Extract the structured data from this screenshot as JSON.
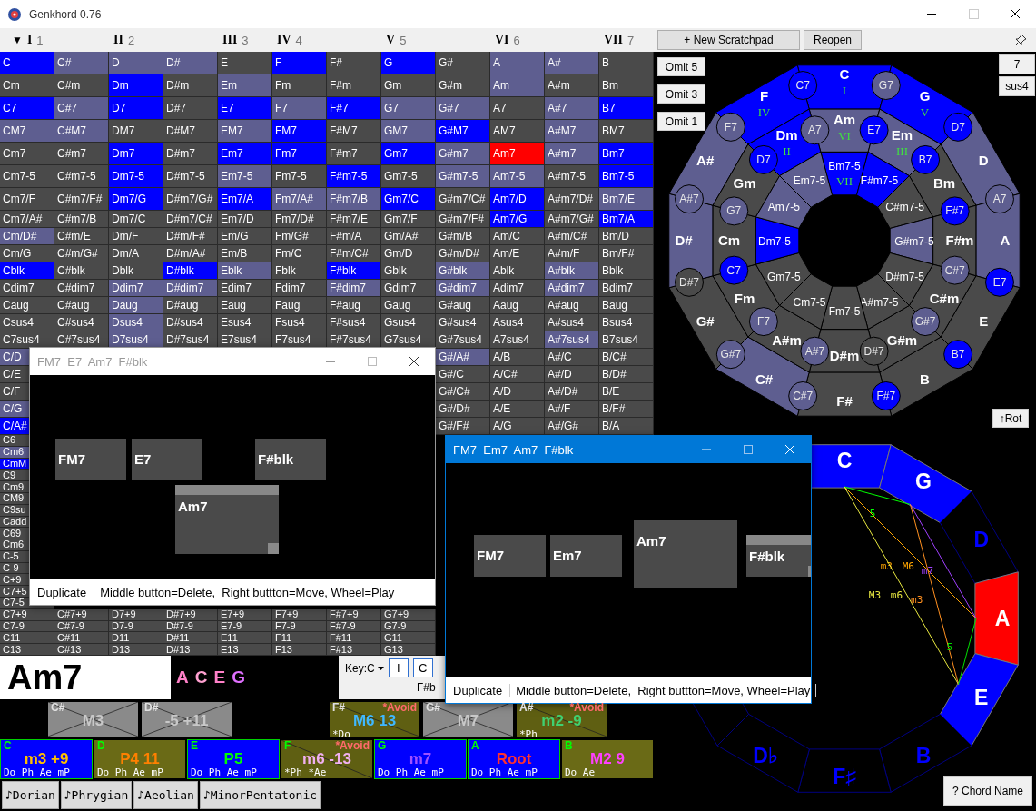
{
  "window": {
    "title": "Genkhord 0.76"
  },
  "toolbar": {
    "columns": [
      {
        "caret": "▼",
        "degree": "I",
        "number": "1"
      },
      {},
      {
        "degree": "II",
        "number": "2"
      },
      {},
      {
        "degree": "III",
        "number": "3"
      },
      {
        "degree": "IV",
        "number": "4"
      },
      {},
      {
        "degree": "V",
        "number": "5"
      },
      {},
      {
        "degree": "VI",
        "number": "6"
      },
      {},
      {
        "degree": "VII",
        "number": "7"
      }
    ],
    "buttons": [
      "+ New Scratchpad",
      "Reopen"
    ]
  },
  "grid": {
    "rows": [
      {
        "cells": [
          {
            "label": "C",
            "color": "#0000ff"
          },
          {
            "label": "C#",
            "color": "#5e5e90"
          },
          {
            "label": "D",
            "color": "#5e5e90"
          },
          {
            "label": "D#",
            "color": "#5e5e90"
          },
          {
            "label": "E",
            "color": "#4a4a4a"
          },
          {
            "label": "F",
            "color": "#0000ff"
          },
          {
            "label": "F#",
            "color": "#4a4a4a"
          },
          {
            "label": "G",
            "color": "#0000ff"
          },
          {
            "label": "G#",
            "color": "#4a4a4a"
          },
          {
            "label": "A",
            "color": "#5e5e90"
          },
          {
            "label": "A#",
            "color": "#5e5e90"
          },
          {
            "label": "B",
            "color": "#4a4a4a"
          }
        ]
      },
      {
        "cells": [
          {
            "label": "Cm",
            "color": "#4a4a4a"
          },
          {
            "label": "C#m",
            "color": "#4a4a4a"
          },
          {
            "label": "Dm",
            "color": "#0000ff"
          },
          {
            "label": "D#m",
            "color": "#4a4a4a"
          },
          {
            "label": "Em",
            "color": "#5e5e90"
          },
          {
            "label": "Fm",
            "color": "#4a4a4a"
          },
          {
            "label": "F#m",
            "color": "#4a4a4a"
          },
          {
            "label": "Gm",
            "color": "#4a4a4a"
          },
          {
            "label": "G#m",
            "color": "#4a4a4a"
          },
          {
            "label": "Am",
            "color": "#5e5e90"
          },
          {
            "label": "A#m",
            "color": "#4a4a4a"
          },
          {
            "label": "Bm",
            "color": "#4a4a4a"
          }
        ]
      },
      {
        "cells": [
          {
            "label": "C7",
            "color": "#0000ff"
          },
          {
            "label": "C#7",
            "color": "#5e5e90"
          },
          {
            "label": "D7",
            "color": "#0000ff"
          },
          {
            "label": "D#7",
            "color": "#4a4a4a"
          },
          {
            "label": "E7",
            "color": "#0000ff"
          },
          {
            "label": "F7",
            "color": "#5e5e90"
          },
          {
            "label": "F#7",
            "color": "#0000ff"
          },
          {
            "label": "G7",
            "color": "#5e5e90"
          },
          {
            "label": "G#7",
            "color": "#5e5e90"
          },
          {
            "label": "A7",
            "color": "#4a4a4a"
          },
          {
            "label": "A#7",
            "color": "#5e5e90"
          },
          {
            "label": "B7",
            "color": "#0000ff"
          }
        ]
      },
      {
        "cells": [
          {
            "label": "CM7",
            "color": "#5e5e90"
          },
          {
            "label": "C#M7",
            "color": "#5e5e90"
          },
          {
            "label": "DM7",
            "color": "#4a4a4a"
          },
          {
            "label": "D#M7",
            "color": "#4a4a4a"
          },
          {
            "label": "EM7",
            "color": "#5e5e90"
          },
          {
            "label": "FM7",
            "color": "#0000ff"
          },
          {
            "label": "F#M7",
            "color": "#4a4a4a"
          },
          {
            "label": "GM7",
            "color": "#5e5e90"
          },
          {
            "label": "G#M7",
            "color": "#0000ff"
          },
          {
            "label": "AM7",
            "color": "#4a4a4a"
          },
          {
            "label": "A#M7",
            "color": "#5e5e90"
          },
          {
            "label": "BM7",
            "color": "#4a4a4a"
          }
        ]
      },
      {
        "cells": [
          {
            "label": "Cm7",
            "color": "#4a4a4a"
          },
          {
            "label": "C#m7",
            "color": "#4a4a4a"
          },
          {
            "label": "Dm7",
            "color": "#0000ff"
          },
          {
            "label": "D#m7",
            "color": "#4a4a4a"
          },
          {
            "label": "Em7",
            "color": "#0000ff"
          },
          {
            "label": "Fm7",
            "color": "#0000ff"
          },
          {
            "label": "F#m7",
            "color": "#4a4a4a"
          },
          {
            "label": "Gm7",
            "color": "#0000ff"
          },
          {
            "label": "G#m7",
            "color": "#5e5e90"
          },
          {
            "label": "Am7",
            "color": "#ff0000"
          },
          {
            "label": "A#m7",
            "color": "#5e5e90"
          },
          {
            "label": "Bm7",
            "color": "#0000ff"
          }
        ]
      },
      {
        "cells": [
          {
            "label": "Cm7-5",
            "color": "#4a4a4a"
          },
          {
            "label": "C#m7-5",
            "color": "#4a4a4a"
          },
          {
            "label": "Dm7-5",
            "color": "#0000ff"
          },
          {
            "label": "D#m7-5",
            "color": "#4a4a4a"
          },
          {
            "label": "Em7-5",
            "color": "#5e5e90"
          },
          {
            "label": "Fm7-5",
            "color": "#4a4a4a"
          },
          {
            "label": "F#m7-5",
            "color": "#0000ff"
          },
          {
            "label": "Gm7-5",
            "color": "#4a4a4a"
          },
          {
            "label": "G#m7-5",
            "color": "#5e5e90"
          },
          {
            "label": "Am7-5",
            "color": "#5e5e90"
          },
          {
            "label": "A#m7-5",
            "color": "#4a4a4a"
          },
          {
            "label": "Bm7-5",
            "color": "#0000ff"
          }
        ]
      },
      {
        "cells": [
          {
            "label": "Cm7/F",
            "color": "#4a4a4a"
          },
          {
            "label": "C#m7/F#",
            "color": "#4a4a4a"
          },
          {
            "label": "Dm7/G",
            "color": "#0000ff"
          },
          {
            "label": "D#m7/G#",
            "color": "#4a4a4a"
          },
          {
            "label": "Em7/A",
            "color": "#0000ff"
          },
          {
            "label": "Fm7/A#",
            "color": "#5e5e90"
          },
          {
            "label": "F#m7/B",
            "color": "#5e5e90"
          },
          {
            "label": "Gm7/C",
            "color": "#0000ff"
          },
          {
            "label": "G#m7/C#",
            "color": "#4a4a4a"
          },
          {
            "label": "Am7/D",
            "color": "#0000ff"
          },
          {
            "label": "A#m7/D#",
            "color": "#4a4a4a"
          },
          {
            "label": "Bm7/E",
            "color": "#5e5e90"
          }
        ]
      },
      {
        "cells": [
          {
            "label": "Cm7/A#",
            "color": "#4a4a4a"
          },
          {
            "label": "C#m7/B",
            "color": "#4a4a4a"
          },
          {
            "label": "Dm7/C",
            "color": "#4a4a4a"
          },
          {
            "label": "D#m7/C#",
            "color": "#4a4a4a"
          },
          {
            "label": "Em7/D",
            "color": "#4a4a4a"
          },
          {
            "label": "Fm7/D#",
            "color": "#4a4a4a"
          },
          {
            "label": "F#m7/E",
            "color": "#4a4a4a"
          },
          {
            "label": "Gm7/F",
            "color": "#4a4a4a"
          },
          {
            "label": "G#m7/F#",
            "color": "#4a4a4a"
          },
          {
            "label": "Am7/G",
            "color": "#0000ff"
          },
          {
            "label": "A#m7/G#",
            "color": "#4a4a4a"
          },
          {
            "label": "Bm7/A",
            "color": "#0000ff"
          }
        ]
      },
      {
        "cells": [
          {
            "label": "Cm/D#",
            "color": "#5e5e90"
          },
          {
            "label": "C#m/E",
            "color": "#4a4a4a"
          },
          {
            "label": "Dm/F",
            "color": "#4a4a4a"
          },
          {
            "label": "D#m/F#",
            "color": "#4a4a4a"
          },
          {
            "label": "Em/G",
            "color": "#4a4a4a"
          },
          {
            "label": "Fm/G#",
            "color": "#4a4a4a"
          },
          {
            "label": "F#m/A",
            "color": "#4a4a4a"
          },
          {
            "label": "Gm/A#",
            "color": "#4a4a4a"
          },
          {
            "label": "G#m/B",
            "color": "#4a4a4a"
          },
          {
            "label": "Am/C",
            "color": "#4a4a4a"
          },
          {
            "label": "A#m/C#",
            "color": "#4a4a4a"
          },
          {
            "label": "Bm/D",
            "color": "#4a4a4a"
          }
        ]
      },
      {
        "cells": [
          {
            "label": "Cm/G",
            "color": "#4a4a4a"
          },
          {
            "label": "C#m/G#",
            "color": "#4a4a4a"
          },
          {
            "label": "Dm/A",
            "color": "#4a4a4a"
          },
          {
            "label": "D#m/A#",
            "color": "#4a4a4a"
          },
          {
            "label": "Em/B",
            "color": "#4a4a4a"
          },
          {
            "label": "Fm/C",
            "color": "#4a4a4a"
          },
          {
            "label": "F#m/C#",
            "color": "#4a4a4a"
          },
          {
            "label": "Gm/D",
            "color": "#4a4a4a"
          },
          {
            "label": "G#m/D#",
            "color": "#4a4a4a"
          },
          {
            "label": "Am/E",
            "color": "#4a4a4a"
          },
          {
            "label": "A#m/F",
            "color": "#4a4a4a"
          },
          {
            "label": "Bm/F#",
            "color": "#4a4a4a"
          }
        ]
      },
      {
        "cells": [
          {
            "label": "Cblk",
            "color": "#0000ff"
          },
          {
            "label": "C#blk",
            "color": "#4a4a4a"
          },
          {
            "label": "Dblk",
            "color": "#4a4a4a"
          },
          {
            "label": "D#blk",
            "color": "#0000ff"
          },
          {
            "label": "Eblk",
            "color": "#5e5e90"
          },
          {
            "label": "Fblk",
            "color": "#4a4a4a"
          },
          {
            "label": "F#blk",
            "color": "#0000ff"
          },
          {
            "label": "Gblk",
            "color": "#4a4a4a"
          },
          {
            "label": "G#blk",
            "color": "#5e5e90"
          },
          {
            "label": "Ablk",
            "color": "#4a4a4a"
          },
          {
            "label": "A#blk",
            "color": "#5e5e90"
          },
          {
            "label": "Bblk",
            "color": "#4a4a4a"
          }
        ]
      },
      {
        "cells": [
          {
            "label": "Cdim7",
            "color": "#4a4a4a"
          },
          {
            "label": "C#dim7",
            "color": "#4a4a4a"
          },
          {
            "label": "Ddim7",
            "color": "#5e5e90"
          },
          {
            "label": "D#dim7",
            "color": "#5e5e90"
          },
          {
            "label": "Edim7",
            "color": "#4a4a4a"
          },
          {
            "label": "Fdim7",
            "color": "#4a4a4a"
          },
          {
            "label": "F#dim7",
            "color": "#5e5e90"
          },
          {
            "label": "Gdim7",
            "color": "#4a4a4a"
          },
          {
            "label": "G#dim7",
            "color": "#5e5e90"
          },
          {
            "label": "Adim7",
            "color": "#4a4a4a"
          },
          {
            "label": "A#dim7",
            "color": "#5e5e90"
          },
          {
            "label": "Bdim7",
            "color": "#4a4a4a"
          }
        ]
      },
      {
        "cells": [
          {
            "label": "Caug",
            "color": "#4a4a4a"
          },
          {
            "label": "C#aug",
            "color": "#4a4a4a"
          },
          {
            "label": "Daug",
            "color": "#5e5e90"
          },
          {
            "label": "D#aug",
            "color": "#4a4a4a"
          },
          {
            "label": "Eaug",
            "color": "#4a4a4a"
          },
          {
            "label": "Faug",
            "color": "#4a4a4a"
          },
          {
            "label": "F#aug",
            "color": "#4a4a4a"
          },
          {
            "label": "Gaug",
            "color": "#4a4a4a"
          },
          {
            "label": "G#aug",
            "color": "#4a4a4a"
          },
          {
            "label": "Aaug",
            "color": "#4a4a4a"
          },
          {
            "label": "A#aug",
            "color": "#4a4a4a"
          },
          {
            "label": "Baug",
            "color": "#4a4a4a"
          }
        ]
      },
      {
        "cells": [
          {
            "label": "Csus4",
            "color": "#4a4a4a"
          },
          {
            "label": "C#sus4",
            "color": "#4a4a4a"
          },
          {
            "label": "Dsus4",
            "color": "#5e5e90"
          },
          {
            "label": "D#sus4",
            "color": "#4a4a4a"
          },
          {
            "label": "Esus4",
            "color": "#4a4a4a"
          },
          {
            "label": "Fsus4",
            "color": "#4a4a4a"
          },
          {
            "label": "F#sus4",
            "color": "#4a4a4a"
          },
          {
            "label": "Gsus4",
            "color": "#4a4a4a"
          },
          {
            "label": "G#sus4",
            "color": "#4a4a4a"
          },
          {
            "label": "Asus4",
            "color": "#4a4a4a"
          },
          {
            "label": "A#sus4",
            "color": "#4a4a4a"
          },
          {
            "label": "Bsus4",
            "color": "#4a4a4a"
          }
        ]
      },
      {
        "cells": [
          {
            "label": "C7sus4",
            "color": "#4a4a4a"
          },
          {
            "label": "C#7sus4",
            "color": "#4a4a4a"
          },
          {
            "label": "D7sus4",
            "color": "#5e5e90"
          },
          {
            "label": "D#7sus4",
            "color": "#4a4a4a"
          },
          {
            "label": "E7sus4",
            "color": "#4a4a4a"
          },
          {
            "label": "F7sus4",
            "color": "#4a4a4a"
          },
          {
            "label": "F#7sus4",
            "color": "#4a4a4a"
          },
          {
            "label": "G7sus4",
            "color": "#4a4a4a"
          },
          {
            "label": "G#7sus4",
            "color": "#4a4a4a"
          },
          {
            "label": "A7sus4",
            "color": "#4a4a4a"
          },
          {
            "label": "A#7sus4",
            "color": "#5e5e90"
          },
          {
            "label": "B7sus4",
            "color": "#4a4a4a"
          }
        ]
      },
      {
        "cells": [
          {
            "label": "C/D",
            "color": "#5e5e90"
          },
          {
            "label": "G#/A#",
            "color": "#5e5e90"
          },
          {
            "label": "A/B",
            "color": "#4a4a4a"
          },
          {
            "label": "A#/C",
            "color": "#4a4a4a"
          },
          {
            "label": "B/C#",
            "color": "#4a4a4a"
          }
        ]
      },
      {
        "cells": [
          {
            "label": "C/E",
            "color": "#4a4a4a"
          },
          {
            "label": "G#/C",
            "color": "#4a4a4a"
          },
          {
            "label": "A/C#",
            "color": "#4a4a4a"
          },
          {
            "label": "A#/D",
            "color": "#4a4a4a"
          },
          {
            "label": "B/D#",
            "color": "#4a4a4a"
          }
        ]
      },
      {
        "cells": [
          {
            "label": "C/F",
            "color": "#4a4a4a"
          },
          {
            "label": "G#/C#",
            "color": "#4a4a4a"
          },
          {
            "label": "A/D",
            "color": "#4a4a4a"
          },
          {
            "label": "A#/D#",
            "color": "#4a4a4a"
          },
          {
            "label": "B/E",
            "color": "#4a4a4a"
          }
        ]
      },
      {
        "cells": [
          {
            "label": "C/G",
            "color": "#5e5e90"
          },
          {
            "label": "G#/D#",
            "color": "#4a4a4a"
          },
          {
            "label": "A/E",
            "color": "#4a4a4a"
          },
          {
            "label": "A#/F",
            "color": "#4a4a4a"
          },
          {
            "label": "B/F#",
            "color": "#4a4a4a"
          }
        ]
      },
      {
        "cells": [
          {
            "label": "C/A#",
            "color": "#0000ff"
          },
          {
            "label": "G#/F#",
            "color": "#4a4a4a"
          },
          {
            "label": "A/G",
            "color": "#4a4a4a"
          },
          {
            "label": "A#/G#",
            "color": "#4a4a4a"
          },
          {
            "label": "B/A",
            "color": "#4a4a4a"
          }
        ]
      },
      {
        "cells": [
          {
            "label": "C6",
            "color": "#4a4a4a"
          }
        ]
      },
      {
        "cells": [
          {
            "label": "Cm6",
            "color": "#5e5e90"
          }
        ]
      },
      {
        "cells": [
          {
            "label": "CmM",
            "color": "#0000ff"
          }
        ]
      },
      {
        "cells": [
          {
            "label": "C9",
            "color": "#4a4a4a"
          }
        ]
      },
      {
        "cells": [
          {
            "label": "Cm9",
            "color": "#4a4a4a"
          }
        ]
      },
      {
        "cells": [
          {
            "label": "CM9",
            "color": "#4a4a4a"
          }
        ]
      },
      {
        "cells": [
          {
            "label": "C9su",
            "color": "#4a4a4a"
          }
        ]
      },
      {
        "cells": [
          {
            "label": "Cadd",
            "color": "#4a4a4a"
          }
        ]
      },
      {
        "cells": [
          {
            "label": "C69",
            "color": "#4a4a4a"
          }
        ]
      },
      {
        "cells": [
          {
            "label": "Cm6",
            "color": "#4a4a4a"
          }
        ]
      },
      {
        "cells": [
          {
            "label": "C-5",
            "color": "#4a4a4a"
          }
        ]
      },
      {
        "cells": [
          {
            "label": "C-9",
            "color": "#4a4a4a"
          }
        ]
      },
      {
        "cells": [
          {
            "label": "C+9",
            "color": "#4a4a4a"
          }
        ]
      },
      {
        "cells": [
          {
            "label": "C7+5",
            "color": "#4a4a4a"
          }
        ]
      },
      {
        "cells": [
          {
            "label": "C7-5",
            "color": "#4a4a4a"
          }
        ]
      },
      {
        "cells": [
          {
            "label": "C7+9",
            "color": "#4a4a4a"
          },
          {
            "label": "C#7+9",
            "color": "#4a4a4a"
          },
          {
            "label": "D7+9",
            "color": "#4a4a4a"
          },
          {
            "label": "D#7+9",
            "color": "#4a4a4a"
          },
          {
            "label": "E7+9",
            "color": "#4a4a4a"
          },
          {
            "label": "F7+9",
            "color": "#4a4a4a"
          },
          {
            "label": "F#7+9",
            "color": "#4a4a4a"
          },
          {
            "label": "G7+9",
            "color": "#4a4a4a"
          }
        ]
      },
      {
        "cells": [
          {
            "label": "C7-9",
            "color": "#4a4a4a"
          },
          {
            "label": "C#7-9",
            "color": "#4a4a4a"
          },
          {
            "label": "D7-9",
            "color": "#4a4a4a"
          },
          {
            "label": "D#7-9",
            "color": "#4a4a4a"
          },
          {
            "label": "E7-9",
            "color": "#4a4a4a"
          },
          {
            "label": "F7-9",
            "color": "#4a4a4a"
          },
          {
            "label": "F#7-9",
            "color": "#4a4a4a"
          },
          {
            "label": "G7-9",
            "color": "#4a4a4a"
          }
        ]
      },
      {
        "cells": [
          {
            "label": "C11",
            "color": "#4a4a4a"
          },
          {
            "label": "C#11",
            "color": "#4a4a4a"
          },
          {
            "label": "D11",
            "color": "#4a4a4a"
          },
          {
            "label": "D#11",
            "color": "#4a4a4a"
          },
          {
            "label": "E11",
            "color": "#4a4a4a"
          },
          {
            "label": "F11",
            "color": "#4a4a4a"
          },
          {
            "label": "F#11",
            "color": "#4a4a4a"
          },
          {
            "label": "G11",
            "color": "#4a4a4a"
          }
        ]
      },
      {
        "cells": [
          {
            "label": "C13",
            "color": "#4a4a4a"
          },
          {
            "label": "C#13",
            "color": "#4a4a4a"
          },
          {
            "label": "D13",
            "color": "#4a4a4a"
          },
          {
            "label": "D#13",
            "color": "#4a4a4a"
          },
          {
            "label": "E13",
            "color": "#4a4a4a"
          },
          {
            "label": "F13",
            "color": "#4a4a4a"
          },
          {
            "label": "F#13",
            "color": "#4a4a4a"
          },
          {
            "label": "G13",
            "color": "#4a4a4a"
          }
        ]
      }
    ]
  },
  "chord": {
    "name": "Am7",
    "notes": [
      {
        "label": "A",
        "color": "#ff80c8"
      },
      {
        "label": "C",
        "color": "#ffa0d0"
      },
      {
        "label": "E",
        "color": "#ff80c8"
      },
      {
        "label": "G",
        "color": "#e070ff"
      }
    ]
  },
  "key": {
    "label": "Key:C",
    "buttons": [
      "I",
      "C"
    ],
    "status_text": "F#b"
  },
  "black_keys": [
    {
      "note": "C#",
      "interval": "M3",
      "kind": "excluded"
    },
    {
      "note": "D#",
      "interval": "-5 +11",
      "kind": "excluded"
    },
    {
      "note": "F#",
      "interval": "M6 13",
      "kind": "avoid",
      "color": "#40b8ff",
      "warning": "*Avoid",
      "modes": "*Do"
    },
    {
      "note": "G#",
      "interval": "M7",
      "kind": "excluded"
    },
    {
      "note": "A#",
      "interval": "m2 -9",
      "kind": "avoid",
      "color": "#40d070",
      "warning": "*Avoid",
      "modes": "*Ph"
    }
  ],
  "white_keys": [
    {
      "note": "C",
      "interval": "m3 +9",
      "kind": "chord",
      "color": "#ffc000",
      "modes": "Do Ph Ae mP"
    },
    {
      "note": "D",
      "interval": "P4 11",
      "kind": "scale",
      "color": "#ff8000",
      "modes": "Do Ph Ae mP"
    },
    {
      "note": "E",
      "interval": "P5",
      "kind": "chord",
      "color": "#00ff00",
      "modes": "Do Ph Ae mP"
    },
    {
      "note": "F",
      "interval": "m6 -13",
      "kind": "avoid",
      "color": "#f0b0f0",
      "warning": "*Avoid",
      "modes": "*Ph *Ae"
    },
    {
      "note": "G",
      "interval": "m7",
      "kind": "chord",
      "color": "#a050ff",
      "modes": "Do Ph Ae mP"
    },
    {
      "note": "A",
      "interval": "Root",
      "kind": "chord",
      "color": "#ff3030",
      "modes": "Do Ph Ae mP"
    },
    {
      "note": "B",
      "interval": "M2 9",
      "kind": "scale",
      "color": "#ff40ff",
      "modes": "Do Ae"
    }
  ],
  "scales": [
    "♪Dorian",
    "♪Phrygian",
    "♪Aeolian",
    "♪MinorPentatonic"
  ],
  "side": {
    "omit_buttons": [
      "Omit 5",
      "Omit 3",
      "Omit 1"
    ],
    "extension_buttons": [
      "7",
      "sus4"
    ],
    "rotate_button": "↑Rot",
    "chord_name_button": "? Chord Name"
  },
  "wheel": {
    "majors": [
      {
        "label": "C",
        "degree": "I",
        "color": "#0000ff"
      },
      {
        "label": "G",
        "degree": "V",
        "color": "#0000ff"
      },
      {
        "label": "D",
        "color": "#5e5e90"
      },
      {
        "label": "A",
        "color": "#5e5e90"
      },
      {
        "label": "E",
        "color": "#4a4a4a"
      },
      {
        "label": "B",
        "color": "#4a4a4a"
      },
      {
        "label": "F#",
        "color": "#4a4a4a"
      },
      {
        "label": "C#",
        "color": "#5e5e90"
      },
      {
        "label": "G#",
        "color": "#4a4a4a"
      },
      {
        "label": "D#",
        "color": "#5e5e90"
      },
      {
        "label": "A#",
        "color": "#5e5e90"
      },
      {
        "label": "F",
        "degree": "IV",
        "color": "#0000ff"
      }
    ],
    "minors": [
      {
        "label": "Am",
        "degree": "VI",
        "color": "#5e5e90"
      },
      {
        "label": "Em",
        "degree": "III",
        "color": "#5e5e90"
      },
      {
        "label": "Bm",
        "color": "#4a4a4a"
      },
      {
        "label": "F#m",
        "color": "#4a4a4a"
      },
      {
        "label": "C#m",
        "color": "#4a4a4a"
      },
      {
        "label": "G#m",
        "color": "#4a4a4a"
      },
      {
        "label": "D#m",
        "color": "#4a4a4a"
      },
      {
        "label": "A#m",
        "color": "#4a4a4a"
      },
      {
        "label": "Fm",
        "color": "#4a4a4a"
      },
      {
        "label": "Cm",
        "color": "#4a4a4a"
      },
      {
        "label": "Gm",
        "color": "#4a4a4a"
      },
      {
        "label": "Dm",
        "degree": "II",
        "color": "#0000ff"
      }
    ],
    "diminished": [
      {
        "label": "Bm7-5",
        "degree": "VII",
        "color": "#0000ff"
      },
      {
        "label": "F#m7-5",
        "color": "#0000ff"
      },
      {
        "label": "C#m7-5",
        "color": "#4a4a4a"
      },
      {
        "label": "G#m7-5",
        "color": "#5e5e90"
      },
      {
        "label": "D#m7-5",
        "color": "#4a4a4a"
      },
      {
        "label": "A#m7-5",
        "color": "#4a4a4a"
      },
      {
        "label": "Fm7-5",
        "color": "#4a4a4a"
      },
      {
        "label": "Cm7-5",
        "color": "#4a4a4a"
      },
      {
        "label": "Gm7-5",
        "color": "#4a4a4a"
      },
      {
        "label": "Dm7-5",
        "color": "#0000ff"
      },
      {
        "label": "Am7-5",
        "color": "#5e5e90"
      },
      {
        "label": "Em7-5",
        "color": "#5e5e90"
      }
    ],
    "outer_sevenths": [
      {
        "label": "C7",
        "color": "#0000ff"
      },
      {
        "label": "G7",
        "color": "#5e5e90"
      },
      {
        "label": "D7",
        "color": "#0000ff"
      },
      {
        "label": "A7",
        "color": "#5e5e90"
      },
      {
        "label": "E7",
        "color": "#0000ff"
      },
      {
        "label": "B7",
        "color": "#0000ff"
      },
      {
        "label": "F#7",
        "color": "#0000ff"
      },
      {
        "label": "C#7",
        "color": "#5e5e90"
      },
      {
        "label": "G#7",
        "color": "#5e5e90"
      },
      {
        "label": "D#7",
        "color": "#4a4a4a"
      },
      {
        "label": "A#7",
        "color": "#5e5e90"
      },
      {
        "label": "F7",
        "color": "#5e5e90"
      }
    ],
    "inner_sevenths": [
      {
        "label": "A7",
        "color": "#5e5e90"
      },
      {
        "label": "E7",
        "color": "#0000ff"
      },
      {
        "label": "B7",
        "color": "#0000ff"
      },
      {
        "label": "F#7",
        "color": "#0000ff"
      },
      {
        "label": "C#7",
        "color": "#5e5e90"
      },
      {
        "label": "G#7",
        "color": "#5e5e90"
      },
      {
        "label": "D#7",
        "color": "#4a4a4a"
      },
      {
        "label": "A#7",
        "color": "#5e5e90"
      },
      {
        "label": "F7",
        "color": "#5e5e90"
      },
      {
        "label": "C7",
        "color": "#0000ff"
      },
      {
        "label": "G7",
        "color": "#5e5e90"
      },
      {
        "label": "D7",
        "color": "#0000ff"
      }
    ]
  },
  "note_circle": {
    "notes": [
      {
        "label": "C",
        "color": "#0000ff"
      },
      {
        "label": "G",
        "color": "#0000ff"
      },
      {
        "label": "D"
      },
      {
        "label": "A",
        "color": "#ff0000"
      },
      {
        "label": "E",
        "color": "#0000ff"
      },
      {
        "label": "B"
      },
      {
        "label": "F♯"
      },
      {
        "label": "D♭"
      }
    ],
    "intervals": [
      {
        "labels": [
          "5"
        ],
        "color": "#00ff00"
      },
      {
        "labels": [
          "m3",
          "M6"
        ],
        "color": "#ffa500"
      },
      {
        "labels": [
          "M3",
          "m6"
        ],
        "color": "#e8e840"
      },
      {
        "labels": [
          "m7"
        ],
        "color": "#a040ff"
      },
      {
        "labels": [
          "m3"
        ],
        "color": "#ff9020"
      },
      {
        "labels": [
          "5"
        ],
        "color": "#00e000"
      }
    ]
  },
  "scratchpads": [
    {
      "title": "FM7  E7  Am7  F#blk",
      "active": false,
      "blocks": [
        {
          "label": "FM7",
          "selected": false
        },
        {
          "label": "E7",
          "selected": false
        },
        {
          "label": "Am7",
          "selected": true
        },
        {
          "label": "F#blk",
          "selected": false
        }
      ],
      "button": "Duplicate",
      "hint": "Middle button=Delete,  Right buttton=Move, Wheel=Play"
    },
    {
      "title": "FM7  Em7  Am7  F#blk",
      "active": true,
      "blocks": [
        {
          "label": "FM7",
          "selected": false
        },
        {
          "label": "Em7",
          "selected": false
        },
        {
          "label": "Am7",
          "selected": false
        },
        {
          "label": "F#blk",
          "selected": true
        }
      ],
      "button": "Duplicate",
      "hint": "Middle button=Delete,  Right buttton=Move, Wheel=Play"
    }
  ]
}
